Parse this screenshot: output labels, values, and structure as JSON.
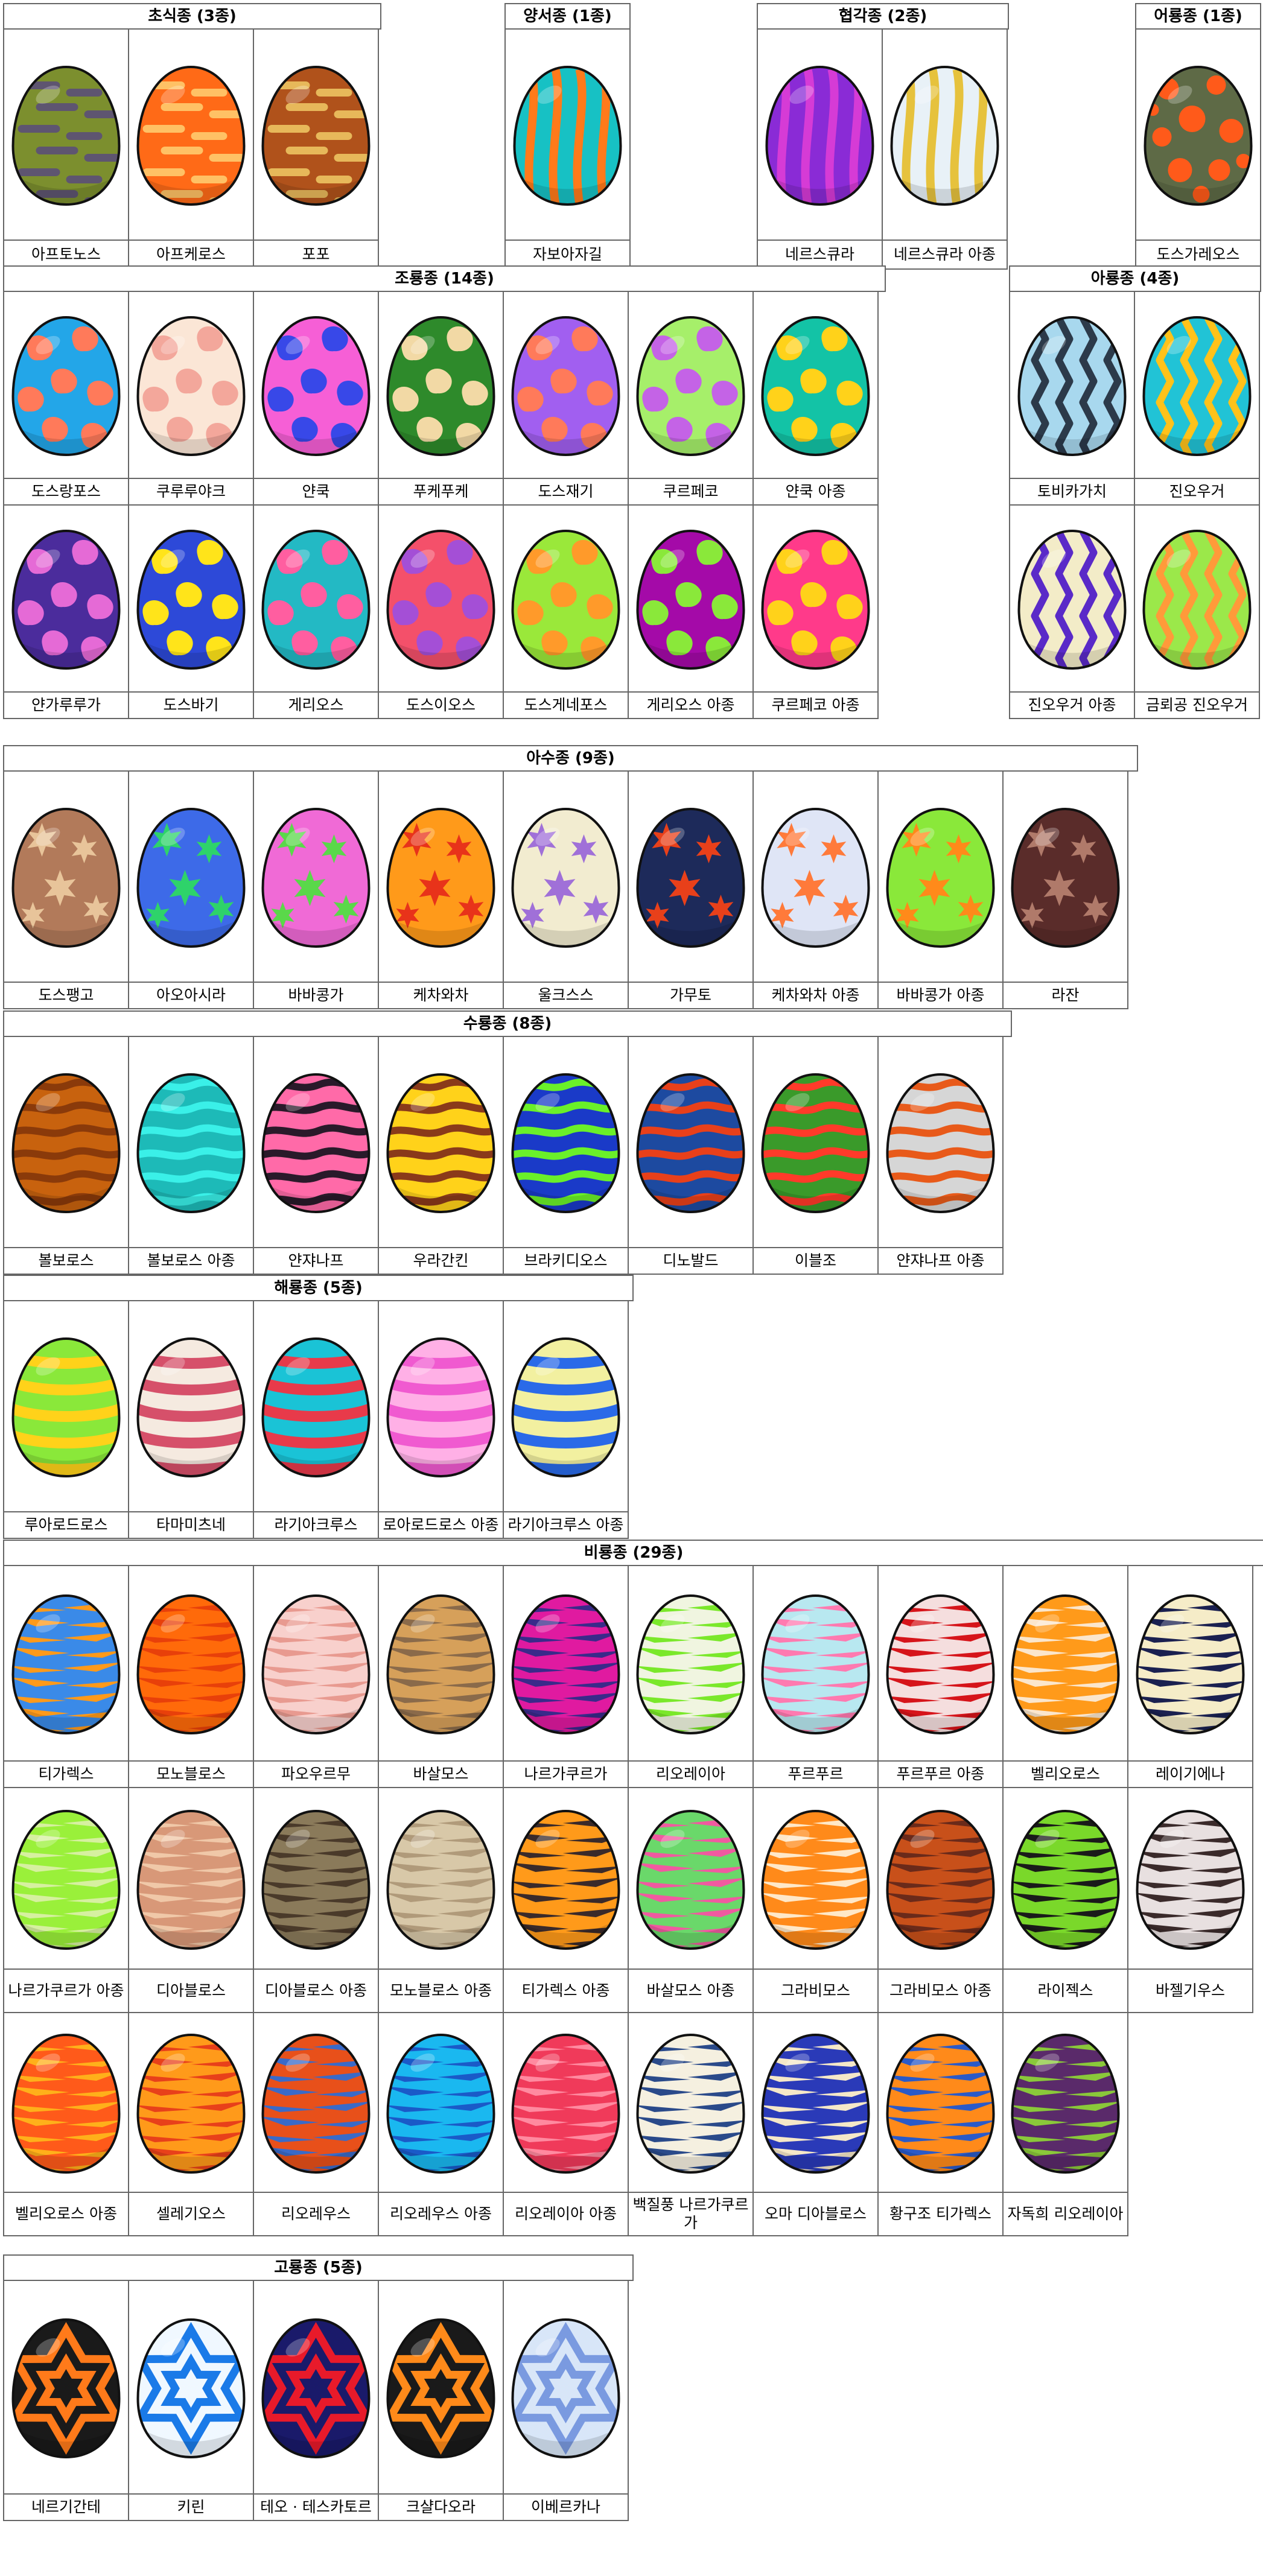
{
  "groups": [
    {
      "title": "초식종 (3종)",
      "eggs": [
        {
          "name": "아프토노스",
          "bg": "#7c8f2e",
          "fg": "#5e5570",
          "pattern": "bands"
        },
        {
          "name": "아프케로스",
          "bg": "#ff6a17",
          "fg": "#ffc165",
          "pattern": "bands"
        },
        {
          "name": "포포",
          "bg": "#b0521b",
          "fg": "#e7b85a",
          "pattern": "bands"
        }
      ]
    },
    {
      "title": "양서종 (1종)",
      "eggs": [
        {
          "name": "자보아자길",
          "bg": "#17c1c4",
          "fg": "#ff7a1a",
          "pattern": "vstripe"
        }
      ]
    },
    {
      "title": "협각종 (2종)",
      "eggs": [
        {
          "name": "네르스큐라",
          "bg": "#8a2bd6",
          "fg": "#d63bd6",
          "pattern": "vstripe"
        },
        {
          "name": "네르스큐라 아종",
          "bg": "#e8f1f7",
          "fg": "#e6c23d",
          "pattern": "vstripe"
        }
      ]
    },
    {
      "title": "어룡종 (1종)",
      "eggs": [
        {
          "name": "도스가레오스",
          "bg": "#5e6a46",
          "fg": "#ff5a1a",
          "pattern": "dots"
        }
      ]
    },
    {
      "title": "조룡종 (14종)",
      "eggs": [
        {
          "name": "도스랑포스",
          "bg": "#23a6e8",
          "fg": "#ff7a5a",
          "pattern": "spots"
        },
        {
          "name": "쿠루루야크",
          "bg": "#fbe6d6",
          "fg": "#f3a79b",
          "pattern": "spots"
        },
        {
          "name": "얀쿡",
          "bg": "#f65fd6",
          "fg": "#3848e8",
          "pattern": "spots"
        },
        {
          "name": "푸케푸케",
          "bg": "#2e8a2b",
          "fg": "#f2d9a5",
          "pattern": "spots"
        },
        {
          "name": "도스재기",
          "bg": "#a15ff0",
          "fg": "#ff7a5a",
          "pattern": "spots"
        },
        {
          "name": "쿠르페코",
          "bg": "#a6ef6a",
          "fg": "#c463e6",
          "pattern": "spots"
        },
        {
          "name": "얀쿡 아종",
          "bg": "#13c3a6",
          "fg": "#ffd21a",
          "pattern": "spots"
        },
        {
          "name": "얀가루루가",
          "bg": "#4b2c9c",
          "fg": "#e56ad6",
          "pattern": "spots"
        },
        {
          "name": "도스바기",
          "bg": "#2d49d8",
          "fg": "#ffe41a",
          "pattern": "spots"
        },
        {
          "name": "게리오스",
          "bg": "#23b9c4",
          "fg": "#ff5ea0",
          "pattern": "spots"
        },
        {
          "name": "도스이오스",
          "bg": "#f4506a",
          "fg": "#a44fd6",
          "pattern": "spots"
        },
        {
          "name": "도스게네포스",
          "bg": "#9ae83a",
          "fg": "#ff9a2a",
          "pattern": "spots"
        },
        {
          "name": "게리오스 아종",
          "bg": "#a40aa8",
          "fg": "#8ae83a",
          "pattern": "spots"
        },
        {
          "name": "쿠르페코 아종",
          "bg": "#ff3a8a",
          "fg": "#ffd21a",
          "pattern": "spots"
        }
      ]
    },
    {
      "title": "아룡종 (4종)",
      "eggs": [
        {
          "name": "토비카가치",
          "bg": "#a8d8ee",
          "fg": "#2c3a4a",
          "pattern": "zigzag"
        },
        {
          "name": "진오우거",
          "bg": "#21c3d6",
          "fg": "#ffc21a",
          "pattern": "zigzag"
        },
        {
          "name": "진오우거 아종",
          "bg": "#f3ecc8",
          "fg": "#5a2ac8",
          "pattern": "zigzag"
        },
        {
          "name": "금뢰공 진오우거",
          "bg": "#9be84a",
          "fg": "#ff9a3a",
          "pattern": "zigzag"
        }
      ]
    },
    {
      "title": "아수종 (9종)",
      "eggs": [
        {
          "name": "도스팽고",
          "bg": "#b27a5a",
          "fg": "#e8c49a",
          "pattern": "stars"
        },
        {
          "name": "아오아시라",
          "bg": "#3d6ae8",
          "fg": "#2ed36a",
          "pattern": "stars"
        },
        {
          "name": "바바콩가",
          "bg": "#f06ad6",
          "fg": "#5ad84a",
          "pattern": "stars"
        },
        {
          "name": "케차와차",
          "bg": "#ff9a1a",
          "fg": "#e8331a",
          "pattern": "stars"
        },
        {
          "name": "울크스스",
          "bg": "#f2ecd0",
          "fg": "#a070d8",
          "pattern": "stars"
        },
        {
          "name": "가무토",
          "bg": "#1d2a5a",
          "fg": "#e8401a",
          "pattern": "stars"
        },
        {
          "name": "케차와차 아종",
          "bg": "#dfe5f6",
          "fg": "#ff7a3a",
          "pattern": "stars"
        },
        {
          "name": "바바콩가 아종",
          "bg": "#8ae83a",
          "fg": "#ff8a1a",
          "pattern": "stars"
        },
        {
          "name": "라잔",
          "bg": "#5a2c2a",
          "fg": "#b07a6a",
          "pattern": "stars"
        }
      ]
    },
    {
      "title": "수룡종 (8종)",
      "eggs": [
        {
          "name": "볼보로스",
          "bg": "#c8620e",
          "fg": "#8a3a0a",
          "pattern": "waves"
        },
        {
          "name": "볼보로스 아종",
          "bg": "#1dbab8",
          "fg": "#3af0e8",
          "pattern": "waves"
        },
        {
          "name": "얀쟈나프",
          "bg": "#ff6aa8",
          "fg": "#2a1a2a",
          "pattern": "waves"
        },
        {
          "name": "우라간킨",
          "bg": "#ffd21a",
          "fg": "#8a3a1a",
          "pattern": "waves"
        },
        {
          "name": "브라키디오스",
          "bg": "#1a3ac8",
          "fg": "#6af02a",
          "pattern": "waves"
        },
        {
          "name": "디노발드",
          "bg": "#1d4aa0",
          "fg": "#e8401a",
          "pattern": "waves"
        },
        {
          "name": "이블조",
          "bg": "#3a9a2a",
          "fg": "#ff3a2a",
          "pattern": "waves"
        },
        {
          "name": "얀쟈나프 아종",
          "bg": "#d6d6d6",
          "fg": "#e85a1a",
          "pattern": "waves"
        }
      ]
    },
    {
      "title": "해룡종 (5종)",
      "eggs": [
        {
          "name": "루아로드로스",
          "bg": "#8ae83a",
          "fg": "#ffd21a",
          "pattern": "hbands"
        },
        {
          "name": "타마미츠네",
          "bg": "#f5eae0",
          "fg": "#d6506a",
          "pattern": "hbands"
        },
        {
          "name": "라기아크루스",
          "bg": "#1ac3d6",
          "fg": "#e83a4a",
          "pattern": "hbands"
        },
        {
          "name": "로아로드로스 아종",
          "bg": "#ffb0e6",
          "fg": "#f05ad0",
          "pattern": "hbands"
        },
        {
          "name": "라기아크루스 아종",
          "bg": "#f2f0a0",
          "fg": "#2a6ae8",
          "pattern": "hbands"
        }
      ]
    },
    {
      "title": "비룡종 (29종)",
      "eggs": [
        {
          "name": "티가렉스",
          "bg": "#3a8ae8",
          "fg": "#ff9a1a",
          "pattern": "tiger"
        },
        {
          "name": "모노블로스",
          "bg": "#ff6a0a",
          "fg": "#e8400a",
          "pattern": "tiger"
        },
        {
          "name": "파오우르무",
          "bg": "#f8d0cc",
          "fg": "#e89a90",
          "pattern": "tiger"
        },
        {
          "name": "바살모스",
          "bg": "#d6a05a",
          "fg": "#8a6a4a",
          "pattern": "tiger"
        },
        {
          "name": "나르가쿠르가",
          "bg": "#e01aa0",
          "fg": "#3a2a8a",
          "pattern": "tiger"
        },
        {
          "name": "리오레이아",
          "bg": "#f0f5e0",
          "fg": "#7ae82a",
          "pattern": "tiger"
        },
        {
          "name": "푸르푸르",
          "bg": "#b8e8f0",
          "fg": "#ff7ab0",
          "pattern": "tiger"
        },
        {
          "name": "푸르푸르 아종",
          "bg": "#f5dede",
          "fg": "#d6141a",
          "pattern": "tiger"
        },
        {
          "name": "벨리오로스",
          "bg": "#ff9a1a",
          "fg": "#fbe6cc",
          "pattern": "tiger"
        },
        {
          "name": "레이기에나",
          "bg": "#f5ecc8",
          "fg": "#1a2050",
          "pattern": "tiger"
        },
        {
          "name": "나르가쿠르가 아종",
          "bg": "#9af03a",
          "fg": "#d6f0a0",
          "pattern": "tiger"
        },
        {
          "name": "디아블로스",
          "bg": "#d89878",
          "fg": "#f0c8a8",
          "pattern": "tiger"
        },
        {
          "name": "디아블로스 아종",
          "bg": "#8a7a5a",
          "fg": "#4a3a2a",
          "pattern": "tiger"
        },
        {
          "name": "모노블로스 아종",
          "bg": "#d8c8a8",
          "fg": "#b09a7a",
          "pattern": "tiger"
        },
        {
          "name": "티가렉스 아종",
          "bg": "#ff9a1a",
          "fg": "#3a2a2a",
          "pattern": "tiger"
        },
        {
          "name": "바살모스 아종",
          "bg": "#6ad86a",
          "fg": "#f05aa0",
          "pattern": "tiger"
        },
        {
          "name": "그라비모스",
          "bg": "#ff8a1a",
          "fg": "#ffe8c8",
          "pattern": "tiger"
        },
        {
          "name": "그라비모스 아종",
          "bg": "#c8501a",
          "fg": "#6a2a1a",
          "pattern": "tiger"
        },
        {
          "name": "라이젝스",
          "bg": "#7ad82a",
          "fg": "#1a1a1a",
          "pattern": "tiger"
        },
        {
          "name": "바젤기우스",
          "bg": "#e8e0e0",
          "fg": "#3a2a2a",
          "pattern": "tiger"
        },
        {
          "name": "벨리오로스 아종",
          "bg": "#ff5a1a",
          "fg": "#ffb01a",
          "pattern": "tiger"
        },
        {
          "name": "셀레기오스",
          "bg": "#ff9a1a",
          "fg": "#e8401a",
          "pattern": "tiger"
        },
        {
          "name": "리오레우스",
          "bg": "#e8501a",
          "fg": "#3a6ac8",
          "pattern": "tiger"
        },
        {
          "name": "리오레우스 아종",
          "bg": "#1ab8f0",
          "fg": "#1a5ac8",
          "pattern": "tiger"
        },
        {
          "name": "리오레이아 아종",
          "bg": "#f03a5a",
          "fg": "#ff8aa0",
          "pattern": "tiger"
        },
        {
          "name": "백질풍 나르가쿠르가",
          "bg": "#f5f0e0",
          "fg": "#2a4a8a",
          "pattern": "tiger"
        },
        {
          "name": "오마 디아블로스",
          "bg": "#2a3ab8",
          "fg": "#f5e8c8",
          "pattern": "tiger"
        },
        {
          "name": "황구조 티가렉스",
          "bg": "#ff8a1a",
          "fg": "#2a5ac8",
          "pattern": "tiger"
        },
        {
          "name": "자독희 리오레이아",
          "bg": "#5a2a6a",
          "fg": "#8ac83a",
          "pattern": "tiger"
        }
      ]
    },
    {
      "title": "고룡종 (5종)",
      "eggs": [
        {
          "name": "네르기간테",
          "bg": "#1a1a1a",
          "fg": "#ff7a1a",
          "pattern": "hexstar"
        },
        {
          "name": "키린",
          "bg": "#f0f8ff",
          "fg": "#1a7ae8",
          "pattern": "hexstar"
        },
        {
          "name": "테오 · 테스카토르",
          "bg": "#1a1a6a",
          "fg": "#e81a2a",
          "pattern": "hexstar"
        },
        {
          "name": "크샬다오라",
          "bg": "#1a1a1a",
          "fg": "#ff8a1a",
          "pattern": "hexstar"
        },
        {
          "name": "이베르카나",
          "bg": "#d8e6f8",
          "fg": "#7a9ae0",
          "pattern": "hexstar"
        }
      ]
    }
  ]
}
